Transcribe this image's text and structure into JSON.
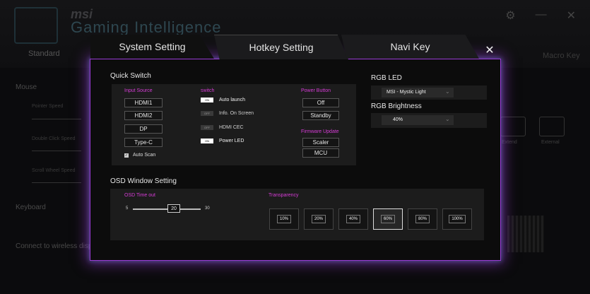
{
  "background": {
    "brand": "msi",
    "app_title": "Gaming Intelligence",
    "tab_standard": "Standard",
    "tab_macro": "Macro Key",
    "left_items": [
      "Mouse",
      "Pointer Speed",
      "Double Click Speed",
      "Scroll Wheel Speed",
      "Keyboard",
      "Connect to wireless display"
    ],
    "external_labels": [
      "Extend",
      "External"
    ]
  },
  "dialog": {
    "tabs": [
      "System Setting",
      "Hotkey Setting",
      "Navi Key"
    ],
    "close_label": "✕",
    "quick_switch": {
      "title": "Quick Switch",
      "input_source_label": "Input Source",
      "inputs": [
        "HDMI1",
        "HDMI2",
        "DP",
        "Type-C"
      ],
      "auto_scan_label": "Auto Scan",
      "switch_label": "switch",
      "switches": [
        {
          "label": "Auto launch",
          "state": "ON"
        },
        {
          "label": "Info. On Screen",
          "state": "OFF"
        },
        {
          "label": "HDMI CEC",
          "state": "OFF"
        },
        {
          "label": "Power LED",
          "state": "ON"
        }
      ],
      "power_button_label": "Power Button",
      "power_options": [
        "Off",
        "Standby"
      ],
      "firmware_update_label": "Firmware Update",
      "firmware_options": [
        "Scaler",
        "MCU"
      ]
    },
    "rgb": {
      "led_title": "RGB LED",
      "led_value": "MSI - Mystic Light",
      "brightness_title": "RGB Brightness",
      "brightness_value": "40%"
    },
    "osd": {
      "title": "OSD Window Setting",
      "timeout_label": "OSD Time out",
      "timeout_min": "5",
      "timeout_value": "20",
      "timeout_max": "30",
      "transparency_label": "Transparency",
      "transparency_options": [
        "10%",
        "20%",
        "40%",
        "60%",
        "80%",
        "100%"
      ],
      "transparency_selected": "60%"
    }
  },
  "colors": {
    "accent": "#d63cd6",
    "glow": "#9a3bd6"
  }
}
